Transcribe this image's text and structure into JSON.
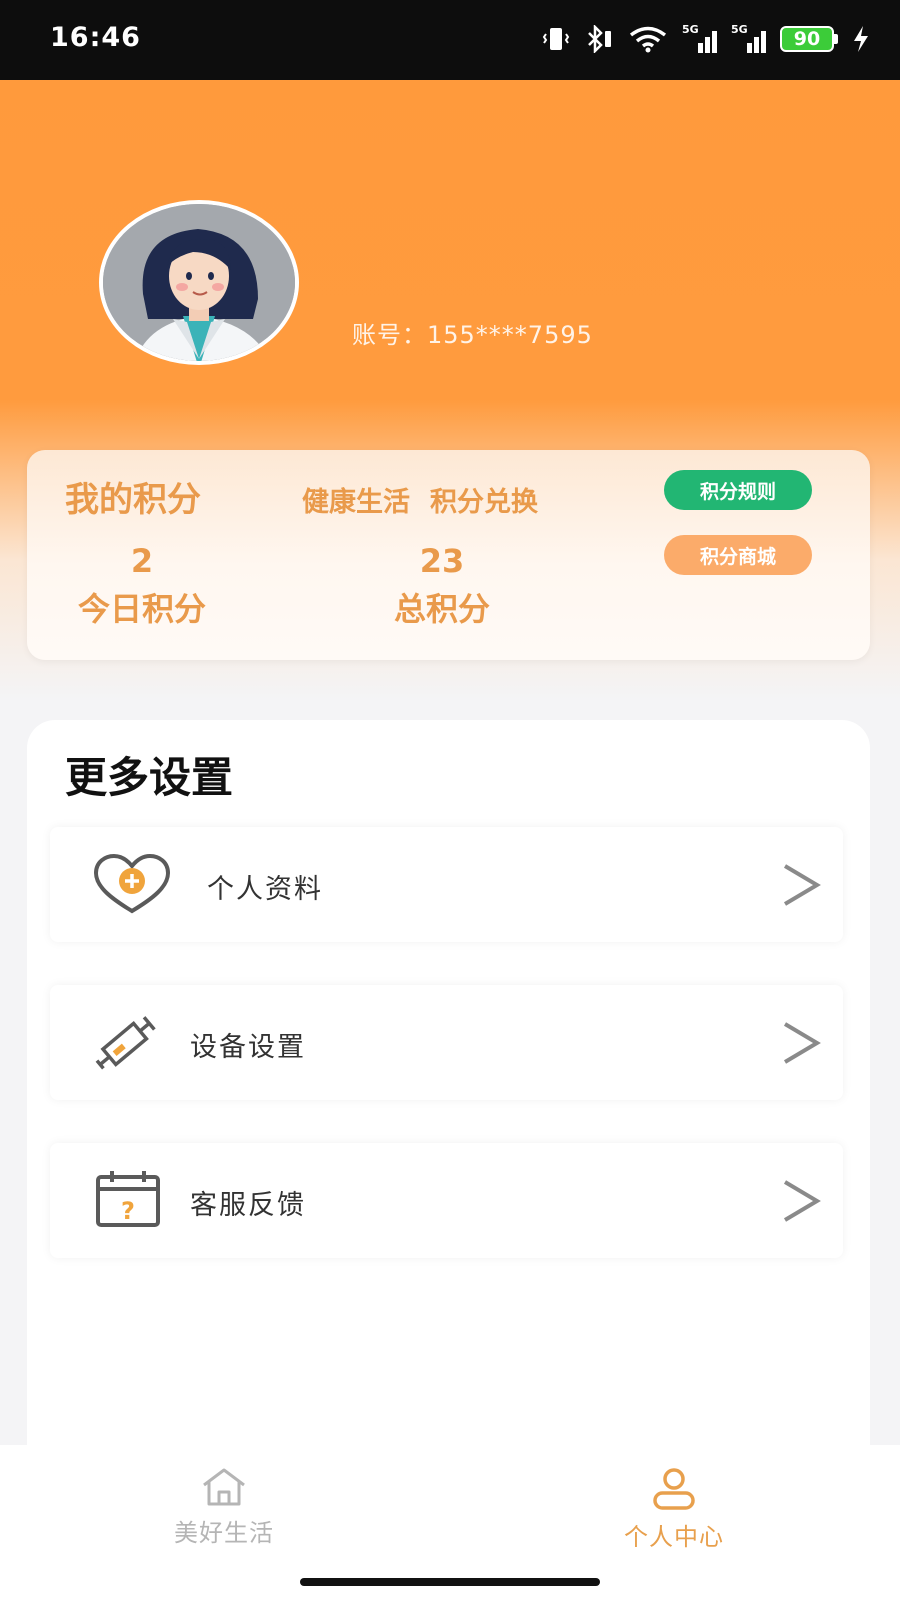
{
  "status_bar": {
    "time": "16:46",
    "battery": "90",
    "signal_1": "5G",
    "signal_2": "5G"
  },
  "profile": {
    "account_label": "账号：",
    "account_value": "155****7595"
  },
  "points": {
    "title": "我的积分",
    "link_healthy": "健康生活",
    "link_exchange": "积分兑换",
    "rules_button": "积分规则",
    "mall_button": "积分商城",
    "today_value": "2",
    "today_label": "今日积分",
    "total_value": "23",
    "total_label": "总积分"
  },
  "settings": {
    "title": "更多设置",
    "items": [
      {
        "label": "个人资料",
        "icon": "heart-plus-icon"
      },
      {
        "label": "设备设置",
        "icon": "syringe-icon"
      },
      {
        "label": "客服反馈",
        "icon": "calendar-question-icon"
      }
    ]
  },
  "bottom_nav": {
    "items": [
      {
        "label": "美好生活",
        "icon": "home-icon",
        "active": false
      },
      {
        "label": "个人中心",
        "icon": "user-icon",
        "active": true
      }
    ]
  },
  "colors": {
    "header_orange": "#ff9a3c",
    "accent_text": "#e99a4b",
    "rules_green": "#22b673",
    "mall_orange": "#fbab6a",
    "nav_active": "#e8a04d",
    "nav_inactive": "#b5b5b5"
  }
}
